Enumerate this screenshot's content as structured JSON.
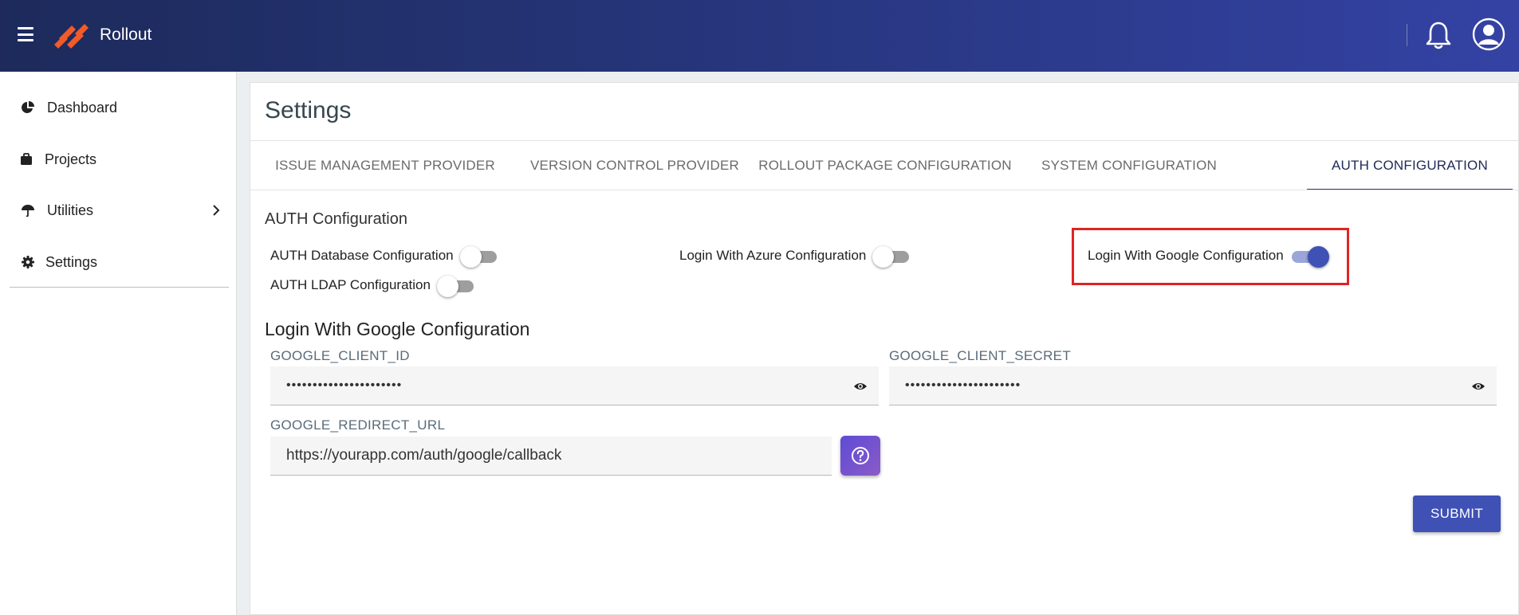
{
  "header": {
    "brand": "Rollout",
    "icons": [
      "menu-icon",
      "rollout-logo",
      "bell-icon",
      "user-avatar-icon"
    ]
  },
  "sidebar": {
    "items": [
      {
        "label": "Dashboard",
        "icon": "pie-chart-icon"
      },
      {
        "label": "Projects",
        "icon": "briefcase-icon"
      },
      {
        "label": "Utilities",
        "icon": "umbrella-icon",
        "has_submenu": true
      },
      {
        "label": "Settings",
        "icon": "gear-icon"
      }
    ]
  },
  "page": {
    "title": "Settings",
    "tabs": [
      {
        "label": "ISSUE MANAGEMENT PROVIDER",
        "active": false
      },
      {
        "label": "VERSION CONTROL PROVIDER",
        "active": false
      },
      {
        "label": "ROLLOUT PACKAGE CONFIGURATION",
        "active": false
      },
      {
        "label": "SYSTEM CONFIGURATION",
        "active": false
      },
      {
        "label": "AUTH CONFIGURATION",
        "active": true
      }
    ]
  },
  "auth": {
    "section_title": "AUTH Configuration",
    "toggles": [
      {
        "label": "AUTH Database Configuration",
        "on": false
      },
      {
        "label": "Login With Azure Configuration",
        "on": false
      },
      {
        "label": "Login With Google Configuration",
        "on": true
      },
      {
        "label": "AUTH LDAP Configuration",
        "on": false
      }
    ],
    "google": {
      "title": "Login With Google Configuration",
      "client_id_label": "GOOGLE_CLIENT_ID",
      "client_id_value": "••••••••••••••••••••••",
      "client_secret_label": "GOOGLE_CLIENT_SECRET",
      "client_secret_value": "••••••••••••••••••••••",
      "redirect_label": "GOOGLE_REDIRECT_URL",
      "redirect_value": "https://yourapp.com/auth/google/callback"
    },
    "submit_label": "SUBMIT"
  },
  "colors": {
    "header_gradient_start": "#1d2a5b",
    "header_gradient_end": "#3442a4",
    "accent": "#3f51b5",
    "logo": "#f15a29",
    "highlight_box": "#e02424"
  }
}
